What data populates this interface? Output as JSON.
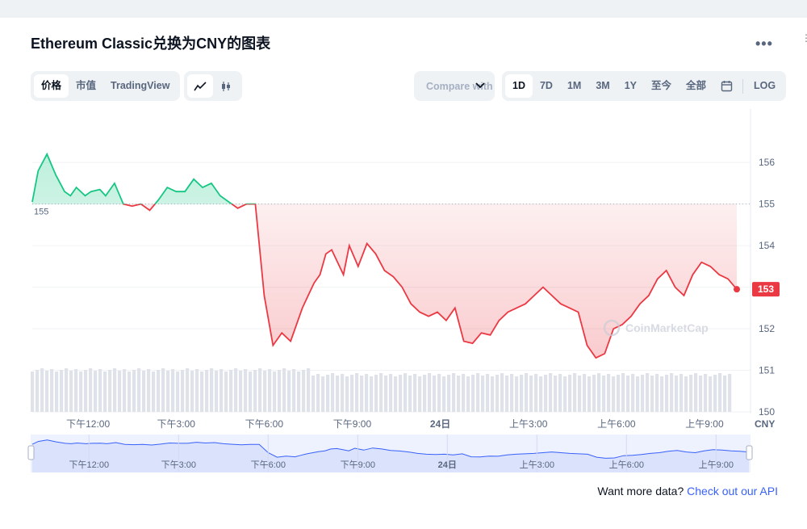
{
  "title": "Ethereum Classic兑换为CNY的图表",
  "more_label": "•••",
  "view_tabs": [
    {
      "label": "价格",
      "active": true
    },
    {
      "label": "市值",
      "active": false
    },
    {
      "label": "TradingView",
      "active": false
    }
  ],
  "chart_type_icons": [
    "line-chart-icon",
    "candlestick-icon"
  ],
  "compare_label": "Compare with",
  "range_tabs": [
    {
      "label": "1D",
      "active": true
    },
    {
      "label": "7D",
      "active": false
    },
    {
      "label": "1M",
      "active": false
    },
    {
      "label": "3M",
      "active": false
    },
    {
      "label": "1Y",
      "active": false
    },
    {
      "label": "至今",
      "active": false
    },
    {
      "label": "全部",
      "active": false
    }
  ],
  "log_label": "LOG",
  "watermark": "CoinMarketCap",
  "footer": {
    "prefix": "Want more data? ",
    "link": "Check out our API"
  },
  "colors": {
    "up": "#16c784",
    "down": "#ea3943",
    "accent": "#3861fb"
  },
  "chart_data": {
    "type": "line",
    "currency_label": "CNY",
    "reference_price": 155,
    "current_price_label": "153",
    "ylim": [
      150,
      156.8
    ],
    "yticks": [
      150,
      151,
      152,
      153,
      154,
      155,
      156
    ],
    "x_tick_labels": [
      "下午12:00",
      "下午3:00",
      "下午6:00",
      "下午9:00",
      "24日",
      "上午3:00",
      "上午6:00",
      "上午9:00"
    ],
    "x_tick_hours": [
      12,
      15,
      18,
      21,
      24,
      27,
      30,
      33
    ],
    "x_range_hours": [
      10.1,
      34.1
    ],
    "series": [
      {
        "x": [
          10.1,
          10.3,
          10.6,
          10.9,
          11.2,
          11.4,
          11.6,
          11.9,
          12.1,
          12.4,
          12.6,
          12.9,
          13.2,
          13.5,
          13.8,
          14.1,
          14.4,
          14.7,
          15.0,
          15.3,
          15.6,
          15.9,
          16.2,
          16.5,
          16.8,
          17.1,
          17.4,
          17.7,
          18.0,
          18.3,
          18.6,
          18.9,
          19.1,
          19.3,
          19.5,
          19.7,
          19.9,
          20.1,
          20.3,
          20.5,
          20.7,
          20.9,
          21.2,
          21.5,
          21.8,
          22.1,
          22.4,
          22.7,
          23.0,
          23.3,
          23.6,
          23.9,
          24.2,
          24.5,
          24.8,
          25.1,
          25.4,
          25.7,
          26.0,
          26.3,
          26.6,
          26.9,
          27.2,
          27.5,
          27.8,
          28.1,
          28.4,
          28.7,
          29.0,
          29.3,
          29.6,
          29.9,
          30.2,
          30.5,
          30.8,
          31.1,
          31.4,
          31.7,
          32.0,
          32.3,
          32.6,
          32.9,
          33.2,
          33.5,
          33.8,
          34.1
        ],
        "values": [
          155.05,
          155.8,
          156.2,
          155.7,
          155.3,
          155.2,
          155.4,
          155.2,
          155.3,
          155.35,
          155.2,
          155.5,
          155.0,
          154.95,
          155.0,
          154.85,
          155.1,
          155.4,
          155.3,
          155.3,
          155.6,
          155.4,
          155.5,
          155.2,
          155.05,
          154.9,
          155.0,
          155.0,
          152.8,
          151.6,
          151.9,
          151.7,
          152.1,
          152.5,
          152.8,
          153.1,
          153.3,
          153.8,
          153.9,
          153.6,
          153.3,
          154.0,
          153.5,
          154.05,
          153.8,
          153.4,
          153.25,
          153.0,
          152.6,
          152.4,
          152.3,
          152.4,
          152.2,
          152.5,
          151.7,
          151.65,
          151.9,
          151.85,
          152.2,
          152.4,
          152.5,
          152.6,
          152.8,
          153.0,
          152.8,
          152.6,
          152.5,
          152.4,
          151.6,
          151.3,
          151.4,
          152.0,
          152.1,
          152.3,
          152.6,
          152.8,
          153.2,
          153.4,
          153.0,
          152.8,
          153.3,
          153.6,
          153.5,
          153.3,
          153.2,
          152.95
        ]
      }
    ]
  }
}
